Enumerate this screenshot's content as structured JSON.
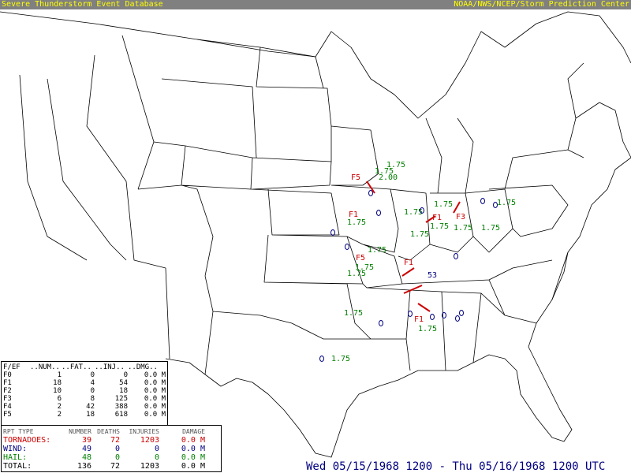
{
  "header": {
    "left_title": "Severe Thunderstorm Event Database",
    "right_title": "NOAA/NWS/NCEP/Storm Prediction Center",
    "colors": {
      "bar": "#808080",
      "text": "#ffff00"
    }
  },
  "map": {
    "region": "Continental United States",
    "colors": {
      "tornado": "#cc0000",
      "wind": "#000080",
      "hail": "#008000",
      "borders": "#000000"
    },
    "labels": [
      {
        "text": "1.75",
        "color": "hail"
      },
      {
        "text": "2.00",
        "color": "hail"
      },
      {
        "text": "F1",
        "color": "tornado"
      },
      {
        "text": "F3",
        "color": "tornado"
      },
      {
        "text": "F5",
        "color": "tornado"
      },
      {
        "text": "53",
        "color": "wind"
      }
    ]
  },
  "fef_table": {
    "headers": [
      "F/EF",
      "..NUM..",
      "..FAT..",
      "..INJ..",
      "..DMG.."
    ],
    "rows": [
      {
        "scale": "F0",
        "num": "1",
        "fat": "0",
        "inj": "0",
        "dmg": "0.0",
        "unit": "M"
      },
      {
        "scale": "F1",
        "num": "18",
        "fat": "4",
        "inj": "54",
        "dmg": "0.0",
        "unit": "M"
      },
      {
        "scale": "F2",
        "num": "10",
        "fat": "0",
        "inj": "18",
        "dmg": "0.0",
        "unit": "M"
      },
      {
        "scale": "F3",
        "num": "6",
        "fat": "8",
        "inj": "125",
        "dmg": "0.0",
        "unit": "M"
      },
      {
        "scale": "F4",
        "num": "2",
        "fat": "42",
        "inj": "388",
        "dmg": "0.0",
        "unit": "M"
      },
      {
        "scale": "F5",
        "num": "2",
        "fat": "18",
        "inj": "618",
        "dmg": "0.0",
        "unit": "M"
      }
    ]
  },
  "report_table": {
    "headers": [
      "RPT TYPE",
      "NUMBER",
      "DEATHS",
      "INJURIES",
      "DAMAGE"
    ],
    "rows": [
      {
        "type": "TORNADOES:",
        "number": "39",
        "deaths": "72",
        "injuries": "1203",
        "damage": "0.0",
        "unit": "M",
        "color": "#cc0000"
      },
      {
        "type": "WIND:",
        "number": "49",
        "deaths": "0",
        "injuries": "0",
        "damage": "0.0",
        "unit": "M",
        "color": "#000080"
      },
      {
        "type": "HAIL:",
        "number": "48",
        "deaths": "0",
        "injuries": "0",
        "damage": "0.0",
        "unit": "M",
        "color": "#008000"
      },
      {
        "type": "TOTAL:",
        "number": "136",
        "deaths": "72",
        "injuries": "1203",
        "damage": "0.0",
        "unit": "M",
        "color": "#000000"
      }
    ]
  },
  "date_range": "Wed 05/15/1968 1200 - Thu 05/16/1968 1200 UTC"
}
